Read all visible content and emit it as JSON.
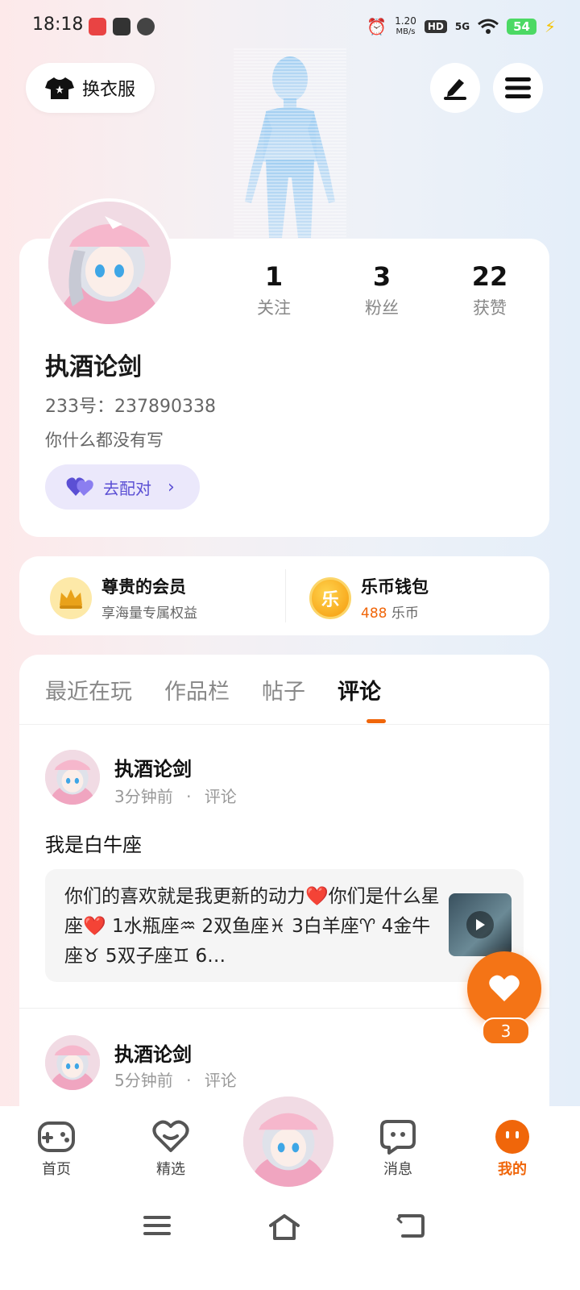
{
  "status_bar": {
    "time": "18:18",
    "network_speed": "1.20",
    "network_unit": "MB/s",
    "hd": "HD",
    "signal": "5G",
    "battery": "54"
  },
  "top": {
    "outfit_label": "换衣服"
  },
  "profile": {
    "stats": [
      {
        "value": "1",
        "label": "关注"
      },
      {
        "value": "3",
        "label": "粉丝"
      },
      {
        "value": "22",
        "label": "获赞"
      }
    ],
    "name": "执酒论剑",
    "uid": "233号：237890338",
    "bio": "你什么都没有写",
    "match_label": "去配对"
  },
  "vip": {
    "member_title": "尊贵的会员",
    "member_sub": "享海量专属权益",
    "wallet_title": "乐币钱包",
    "wallet_amount": "488",
    "wallet_unit": "乐币",
    "wallet_icon_char": "乐"
  },
  "tabs": [
    {
      "label": "最近在玩"
    },
    {
      "label": "作品栏"
    },
    {
      "label": "帖子"
    },
    {
      "label": "评论"
    }
  ],
  "active_tab": "评论",
  "posts": [
    {
      "author": "执酒论剑",
      "time": "3分钟前",
      "type": "评论",
      "text": "我是白牛座",
      "quote": "你们的喜欢就是我更新的动力❤️你们是什么星座❤️ 1水瓶座♒ 2双鱼座♓ 3白羊座♈ 4金牛座♉ 5双子座♊ 6…"
    },
    {
      "author": "执酒论剑",
      "time": "5分钟前",
      "type": "评论"
    }
  ],
  "meta_separator": "·",
  "like_count": "3",
  "nav": {
    "items": [
      {
        "label": "首页"
      },
      {
        "label": "精选"
      },
      {
        "label": "消息"
      },
      {
        "label": "我的"
      }
    ]
  },
  "colors": {
    "accent": "#f0660a",
    "match_purple": "#5b4fd4"
  }
}
